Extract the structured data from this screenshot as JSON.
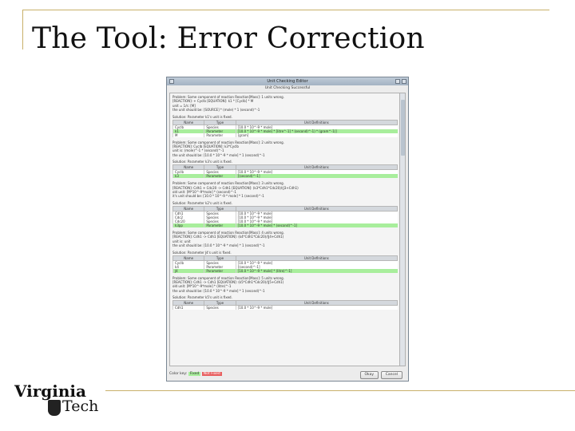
{
  "slide": {
    "title": "The Tool: Error Correction",
    "logo_word1": "Virginia",
    "logo_word2": "Tech"
  },
  "dialog": {
    "title": "Unit Checking Editor",
    "status": "Unit Checking Successful",
    "table_headers": [
      "Name",
      "Type",
      "Unit Definitions"
    ],
    "sections": [
      {
        "problem": [
          "Problem: Some component of reaction Reaction[Mass]: 1 units wrong.",
          "[REACTION]: + Cyclb            [EQUATION]: k1 * [Cyclb] * M",
          "unit = 1/s: [M]",
          "the unit should be: [SOURCE] * (mole) * 1 (second)^-1"
        ],
        "solution": "Solution: Parameter k1's unit is fixed.",
        "rows": [
          {
            "name": "Cyclb",
            "type": "Species",
            "unit": "[10.0 * 10^-9 * mole]",
            "highlight": false
          },
          {
            "name": "k1",
            "type": "Parameter",
            "unit": "[10.0 * 10^-9 * mole] * [litre^-1] * (second)^-1) * (gram^-1)]",
            "highlight": true
          },
          {
            "name": "M",
            "type": "Parameter",
            "unit": "[gram]",
            "highlight": false
          }
        ]
      },
      {
        "problem": [
          "Problem: Some component of reaction Reaction[Mass]: 2 units wrong.",
          "[REACTION]: Cyclb              [EQUATION]: k3*Cyclb",
          "unit is: (mole)^-1 * (second)^-1",
          "the unit should be: [10.0 * 10^-9 * mole] * 1 (second)^-1"
        ],
        "solution": "Solution: Parameter k3's unit is fixed.",
        "rows": [
          {
            "name": "Cyclb",
            "type": "Species",
            "unit": "[10.0 * 10^-9 * mole]",
            "highlight": false
          },
          {
            "name": "k3",
            "type": "Parameter",
            "unit": "[(second)^-1]",
            "highlight": true
          }
        ]
      },
      {
        "problem": [
          "Problem: Some component of reaction Reaction[Mass]: 3 units wrong.",
          "[REACTION]: Cdh1 + Cdc20 -> Cdh1       [EQUATION]: (k3*Cdh1*Cdc20)/(J3+Cdh1)",
          "old unit: [M*10^-9*mole] * (second)^-1",
          "it's unit should be: [10.0 * 10^-9 * mole] * 1 (second)^-1"
        ],
        "solution": "Solution: Parameter k2's unit is fixed.",
        "rows": [
          {
            "name": "Cdh1",
            "type": "Species",
            "unit": "[10.0 * 10^-9 * mole]",
            "highlight": false
          },
          {
            "name": "Cdc2",
            "type": "Species",
            "unit": "[10.0 * 10^-9 * mole]",
            "highlight": false
          },
          {
            "name": "Cdc20",
            "type": "Species",
            "unit": "[10.0 * 10^-9 * mole]",
            "highlight": false
          },
          {
            "name": "k3pp",
            "type": "Parameter",
            "unit": "[10.0 * 10^-9 * mole] * (second)^-1]",
            "highlight": true
          }
        ]
      },
      {
        "problem": [
          "Problem: Some component of reaction Reaction[Mass]: 4 units wrong.",
          "[REACTION]: Cdh1 -> Cdh1         [EQUATION]: (k4*Cdh1*Cdc20)/(J4+Cdh1)",
          "unit is: unit",
          "the unit should be: [10.0 * 10^-9 * mole] * 1 (second)^-1"
        ],
        "solution": "Solution: Parameter J4's unit is fixed.",
        "rows": [
          {
            "name": "Cyclb",
            "type": "Species",
            "unit": "[10.0 * 10^-9 * mole]",
            "highlight": false
          },
          {
            "name": "k4",
            "type": "Parameter",
            "unit": "[(second)^-1]",
            "highlight": false
          },
          {
            "name": "J4",
            "type": "Parameter",
            "unit": "[10.0 * 10^-9 * mole] * (litre)^-1]",
            "highlight": true
          }
        ]
      },
      {
        "problem": [
          "Problem: Some component of reaction Reaction[Mass]: 5 units wrong.",
          "[REACTION]: Cdh1 -> Cdh1         [EQUATION]: (k5*Cdh1*Cdc20)/(J5+Cdh1)",
          "old unit: [M*10^-9*mole] * (litre)^-1",
          "the unit should be: [10.0 * 10^-9 * mole] * 1 (second)^-1"
        ],
        "solution": "Solution: Parameter k5's unit is fixed.",
        "rows": [
          {
            "name": "Cdh1",
            "type": "Species",
            "unit": "[10.0 * 10^-9 * mole]",
            "highlight": false
          }
        ]
      }
    ],
    "legend_label": "Color key:",
    "legend_fixed": "Fixed",
    "legend_not_fixed": "Not Fixed",
    "ok_label": "Okay",
    "cancel_label": "Cancel",
    "colors": {
      "fixed": "#a8ee9c",
      "not_fixed": "#e86060"
    }
  }
}
